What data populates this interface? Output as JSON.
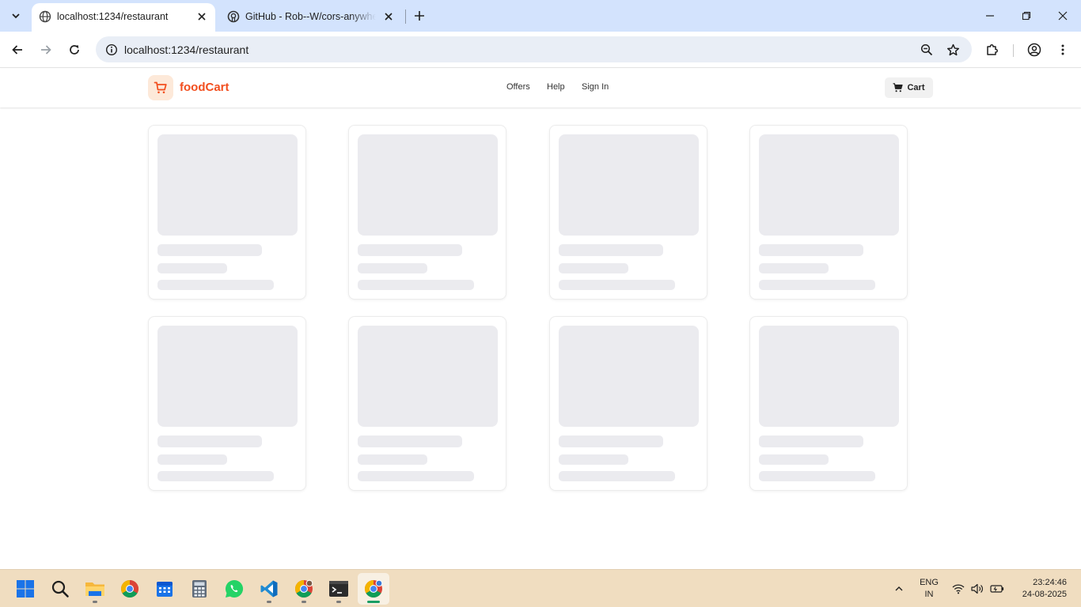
{
  "browser": {
    "tabs": [
      {
        "title": "localhost:1234/restaurant",
        "active": true,
        "favicon": "globe-icon"
      },
      {
        "title": "GitHub - Rob--W/cors-anywhere",
        "active": false,
        "favicon": "github-icon"
      }
    ],
    "address_bar": {
      "url": "localhost:1234/restaurant"
    }
  },
  "app": {
    "brand": "foodCart",
    "brand_color": "#f24e1e",
    "nav": {
      "offers": "Offers",
      "help": "Help",
      "sign_in": "Sign In"
    },
    "cart_label": "Cart",
    "skeleton_cards": {
      "count": 8,
      "state": "loading"
    }
  },
  "taskbar": {
    "apps": [
      "windows-start",
      "search",
      "file-explorer",
      "chrome",
      "calendar",
      "calculator",
      "whatsapp",
      "vscode",
      "chrome-profile",
      "terminal",
      "chrome-active"
    ],
    "language": {
      "line1": "ENG",
      "line2": "IN"
    },
    "time": "23:24:46",
    "date": "24-08-2025"
  }
}
